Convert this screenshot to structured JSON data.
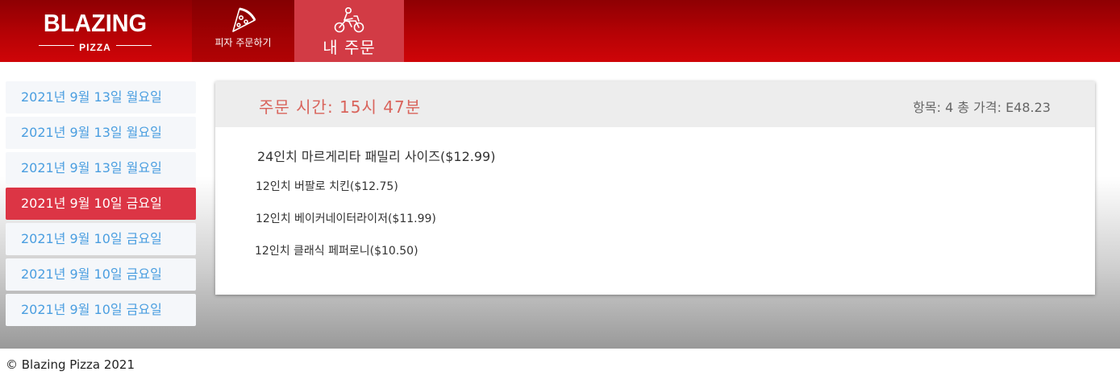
{
  "brand": {
    "name": "BLAZING",
    "sub": "PIZZA"
  },
  "nav": {
    "order_pizza_label": "피자 주문하기",
    "order_pizza_icon": "pizza-slice-icon",
    "my_orders_label": "내 주문",
    "my_orders_icon": "motorbike-delivery-icon"
  },
  "sidebar": {
    "items": [
      {
        "label": "2021년 9월 13일 월요일",
        "active": false
      },
      {
        "label": "2021년 9월 13일 월요일",
        "active": false
      },
      {
        "label": "2021년 9월 13일 월요일",
        "active": false
      },
      {
        "label": "2021년 9월 10일 금요일",
        "active": true
      },
      {
        "label": "2021년 9월 10일 금요일",
        "active": false
      },
      {
        "label": "2021년 9월 10일 금요일",
        "active": false
      },
      {
        "label": "2021년 9월 10일 금요일",
        "active": false
      }
    ]
  },
  "order": {
    "time_label": "주문 시간: 15시 47분",
    "summary": "항목: 4 총 가격: E48.23",
    "items": [
      "24인치 마르게리타 패밀리 사이즈($12.99)",
      "12인치 버팔로 치킨($12.75)",
      "12인치 베이커네이터라이저($11.99)",
      "12인치 클래식 페퍼로니($10.50)"
    ]
  },
  "footer": {
    "text": "© Blazing Pizza 2021"
  },
  "colors": {
    "header_red": "#b60205",
    "active_tab": "#d23b45",
    "active_item": "#dc3545",
    "link_blue": "#4a9ee0",
    "time_text": "#d9645c"
  }
}
